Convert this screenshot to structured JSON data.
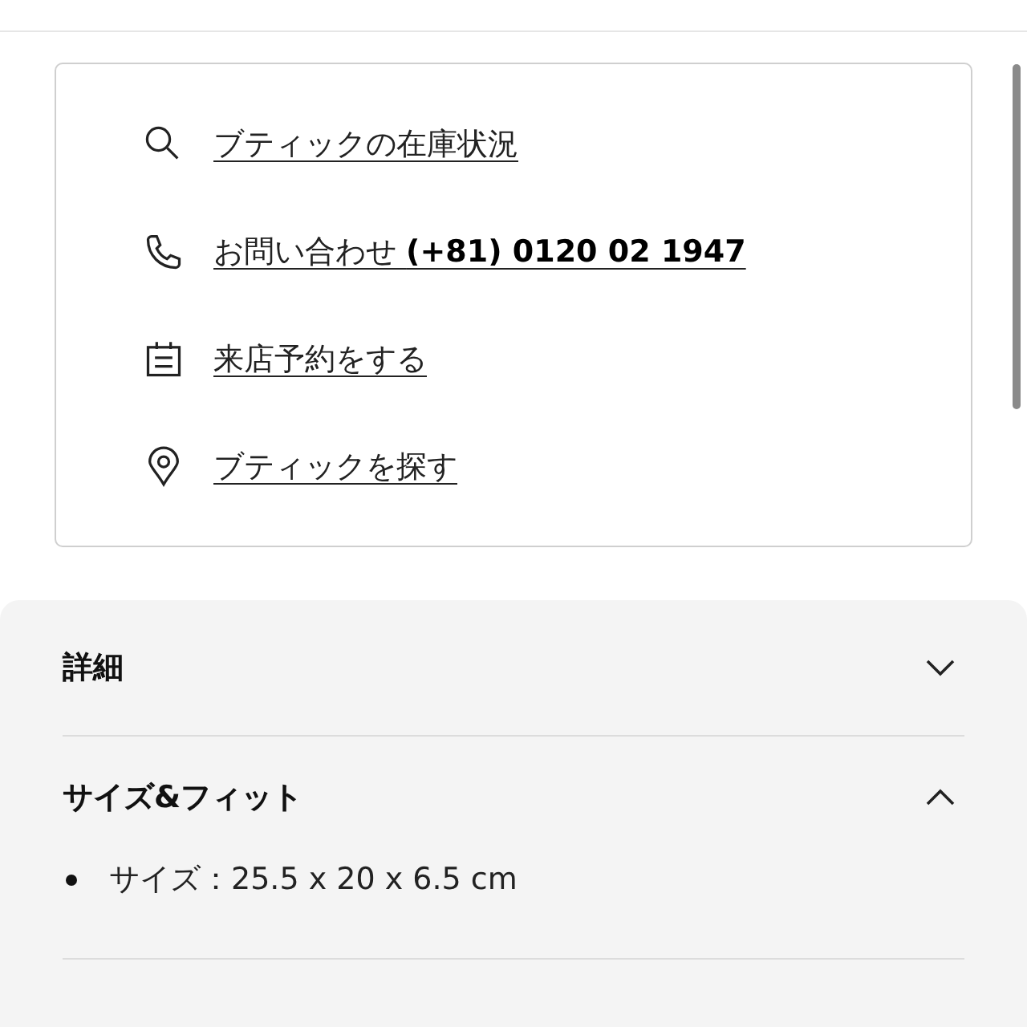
{
  "contact_links": [
    {
      "kind": "search",
      "label": "ブティックの在庫状況"
    },
    {
      "kind": "phone",
      "label": "お問い合わせ **(+81) 0120 02 1947**"
    },
    {
      "kind": "calendar",
      "label": "来店予約をする"
    },
    {
      "kind": "pin",
      "label": "ブティックを探す"
    }
  ],
  "accordion": [
    {
      "title": "詳細",
      "expanded": false
    },
    {
      "title": "サイズ&フィット",
      "expanded": true,
      "bullets": [
        "サイズ：25.5 x 20 x 6.5 cm"
      ]
    }
  ]
}
